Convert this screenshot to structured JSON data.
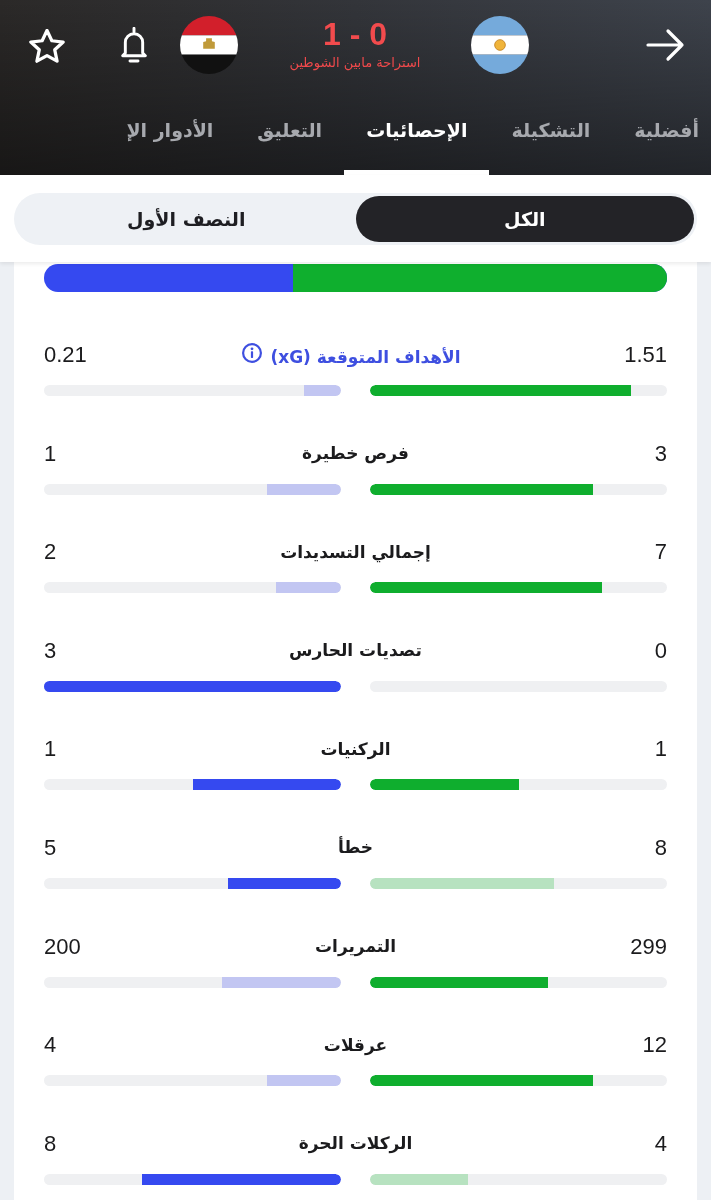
{
  "match": {
    "score": "1 - 0",
    "status": "استراحة مابين الشوطين"
  },
  "tabs": [
    {
      "label": "أفضلية",
      "selected": false
    },
    {
      "label": "التشكيلة",
      "selected": false
    },
    {
      "label": "الإحصائيات",
      "selected": true
    },
    {
      "label": "التعليق",
      "selected": false
    },
    {
      "label": "الأدوار الإ",
      "selected": false
    }
  ],
  "period_filter": [
    {
      "label": "الكل",
      "selected": true
    },
    {
      "label": "النصف الأول",
      "selected": false
    }
  ],
  "possession_bar": {
    "level": 0.6
  },
  "stats": [
    {
      "label": "الأهداف المتوقعة (xG)",
      "kind": "info",
      "home": {
        "value": "1.51",
        "level": 0.88,
        "leading": true
      },
      "away": {
        "value": "0.21",
        "level": 0.125,
        "leading": false
      }
    },
    {
      "label": "فرص خطيرة",
      "kind": "plain",
      "home": {
        "value": "3",
        "level": 0.75,
        "leading": true
      },
      "away": {
        "value": "1",
        "level": 0.25,
        "leading": false
      }
    },
    {
      "label": "إجمالي التسديدات",
      "kind": "plain",
      "home": {
        "value": "7",
        "level": 0.78,
        "leading": true
      },
      "away": {
        "value": "2",
        "level": 0.22,
        "leading": false
      }
    },
    {
      "label": "تصديات الحارس",
      "kind": "plain",
      "home": {
        "value": "0"
      },
      "away": {
        "value": "3",
        "level": 1,
        "leading": true
      }
    },
    {
      "label": "الركنيات",
      "kind": "plain",
      "home": {
        "value": "1",
        "level": 0.5,
        "leading": true
      },
      "away": {
        "value": "1",
        "level": 0.5,
        "leading": true
      }
    },
    {
      "label": "خطأ",
      "kind": "plain",
      "home": {
        "value": "8",
        "level": 0.62,
        "leading": false
      },
      "away": {
        "value": "5",
        "level": 0.38,
        "leading": true
      }
    },
    {
      "label": "التمريرات",
      "kind": "plain",
      "home": {
        "value": "299",
        "level": 0.6,
        "leading": true
      },
      "away": {
        "value": "200",
        "level": 0.4,
        "leading": false
      }
    },
    {
      "label": "عرقلات",
      "kind": "plain",
      "home": {
        "value": "12",
        "level": 0.75,
        "leading": true
      },
      "away": {
        "value": "4",
        "level": 0.25,
        "leading": false
      }
    },
    {
      "label": "الركلات الحرة",
      "kind": "plain",
      "home": {
        "value": "4",
        "level": 0.33,
        "leading": false
      },
      "away": {
        "value": "8",
        "level": 0.67,
        "leading": true
      }
    }
  ]
}
